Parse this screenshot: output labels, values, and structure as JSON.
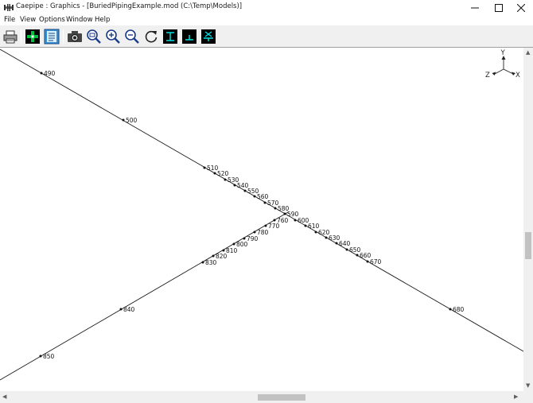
{
  "window": {
    "title": "Caepipe : Graphics -  [BuriedPipingExample.mod (C:\\Temp\\Models)]"
  },
  "menu": [
    "File",
    "View",
    "Options",
    "Window",
    "Help"
  ],
  "toolbar": {
    "icons": [
      "print-icon",
      "add-node-icon",
      "list-icon",
      "camera-icon",
      "zoom-window-icon",
      "zoom-in-icon",
      "zoom-out-icon",
      "rotate-icon",
      "view-front-icon",
      "view-side-icon",
      "view-top-icon"
    ]
  },
  "axes": {
    "y": "Y",
    "z": "Z",
    "x": "X"
  },
  "nodes_upper": [
    "490",
    "500",
    "510",
    "520",
    "530",
    "540",
    "550",
    "560",
    "570",
    "580",
    "590",
    "600",
    "610",
    "620",
    "630",
    "640",
    "650",
    "660",
    "670",
    "680"
  ],
  "nodes_lower": [
    "760",
    "770",
    "780",
    "790",
    "800",
    "810",
    "820",
    "830",
    "840",
    "850"
  ],
  "colors": {
    "line": "#1a1a1a",
    "background": "#ffffff",
    "toolbar": "#f0f0f0"
  }
}
